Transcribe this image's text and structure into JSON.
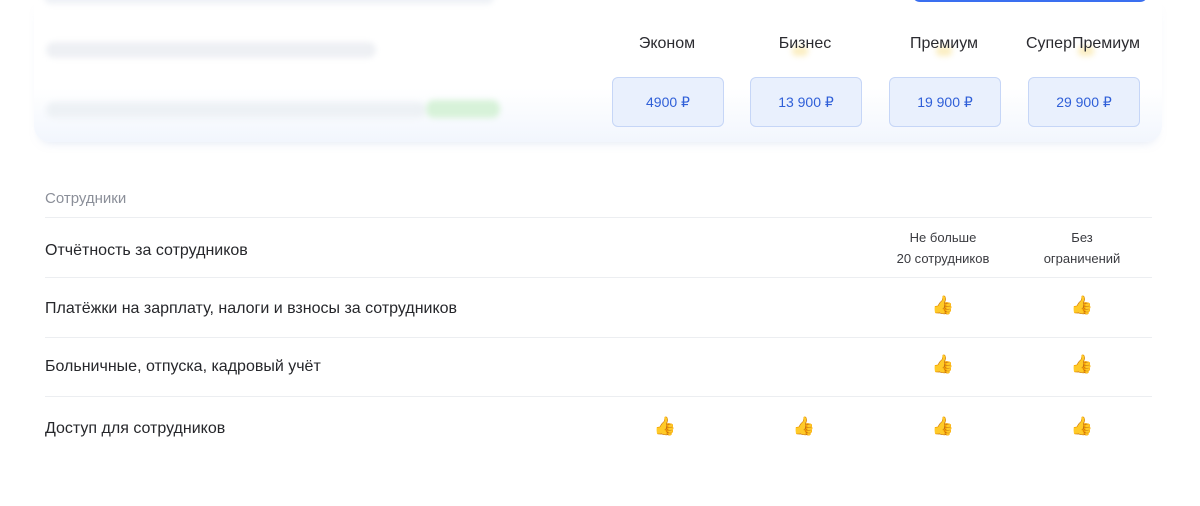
{
  "plans": [
    {
      "name": "Эконом",
      "price": "4900 ₽"
    },
    {
      "name": "Бизнес",
      "price": "13 900 ₽"
    },
    {
      "name": "Премиум",
      "price": "19 900 ₽"
    },
    {
      "name": "СуперПремиум",
      "price": "29 900 ₽"
    }
  ],
  "section": {
    "title": "Сотрудники",
    "rows": [
      {
        "label": "Отчётность за сотрудников",
        "cells": [
          "",
          "",
          "Не больше\n20 сотрудников",
          "Без\nограничений"
        ]
      },
      {
        "label": "Платёжки на зарплату, налоги и взносы за сотрудников",
        "cells": [
          "",
          "",
          "👍",
          "👍"
        ]
      },
      {
        "label": "Больничные, отпуска, кадровый учёт",
        "cells": [
          "",
          "",
          "👍",
          "👍"
        ]
      },
      {
        "label": "Доступ для сотрудников",
        "cells": [
          "👍",
          "👍",
          "👍",
          "👍"
        ]
      }
    ]
  },
  "icons": {
    "included": "thumbs-up-icon"
  },
  "colors": {
    "accent": "#2f5fd8",
    "price_bg": "#e9f0fd",
    "muted": "#8b8f99"
  }
}
